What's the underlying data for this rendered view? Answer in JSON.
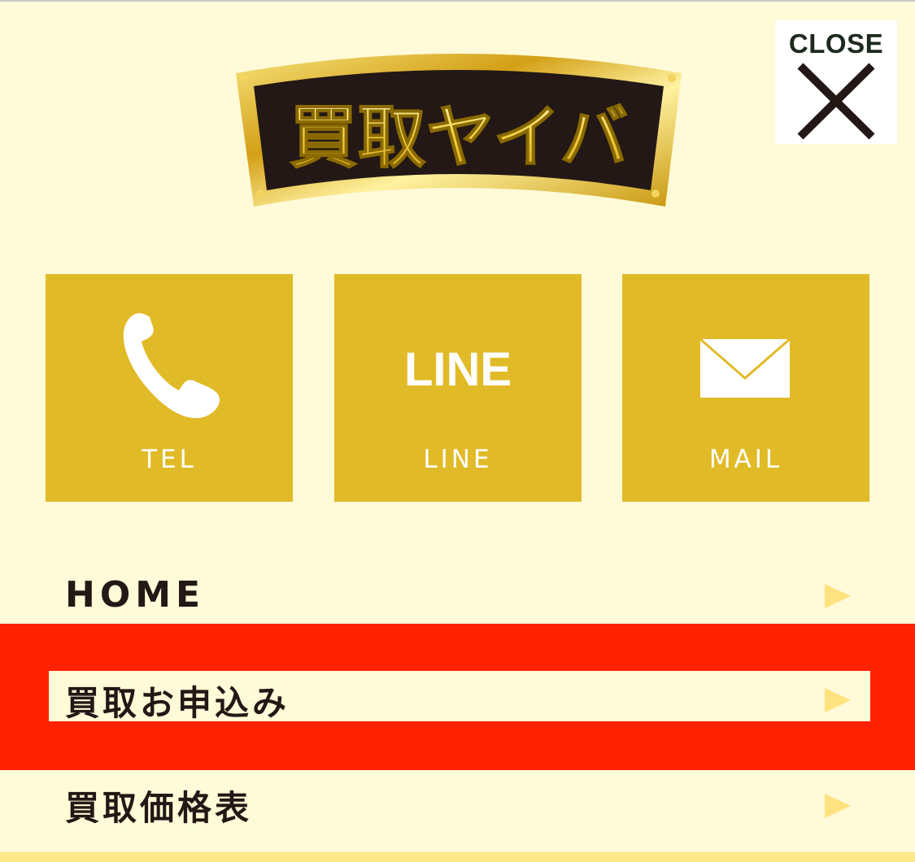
{
  "header": {
    "logo_text": "買取ヤイバ",
    "close_label": "CLOSE"
  },
  "contact": {
    "tel_label": "TEL",
    "line_label": "LINE",
    "line_icon_text": "LINE",
    "mail_label": "MAIL"
  },
  "menu": {
    "items": [
      {
        "label": "HOME"
      },
      {
        "label": "買取お申込み"
      },
      {
        "label": "買取価格表"
      }
    ]
  },
  "colors": {
    "background": "#fffad8",
    "tile": "#e1ba27",
    "highlight": "#ff2200",
    "arrow": "#fde27f"
  }
}
